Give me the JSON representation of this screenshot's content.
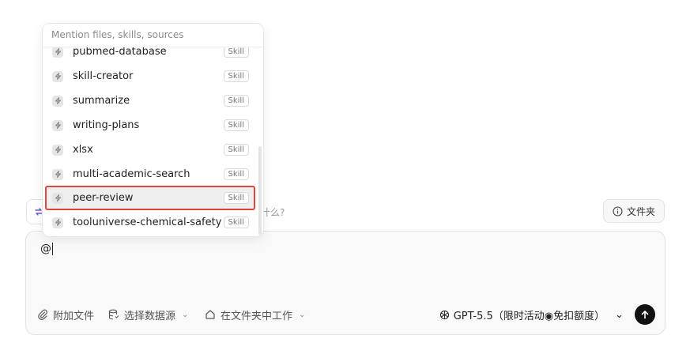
{
  "prompt_row": {
    "suggestion_text": "什么?",
    "folder_label": "文件夹"
  },
  "composer": {
    "value": "@",
    "toolbar": {
      "attach_label": "附加文件",
      "datasource_label": "选择数据源",
      "workspace_label": "在文件夹中工作",
      "model_label": "GPT-5.5（限时活动◉免扣额度）"
    }
  },
  "mention_popup": {
    "placeholder": "Mention files, skills, sources",
    "items": [
      {
        "label": "pubmed-database",
        "badge": "Skill"
      },
      {
        "label": "skill-creator",
        "badge": "Skill"
      },
      {
        "label": "summarize",
        "badge": "Skill"
      },
      {
        "label": "writing-plans",
        "badge": "Skill"
      },
      {
        "label": "xlsx",
        "badge": "Skill"
      },
      {
        "label": "multi-academic-search",
        "badge": "Skill"
      },
      {
        "label": "peer-review",
        "badge": "Skill",
        "selected": true
      },
      {
        "label": "tooluniverse-chemical-safety",
        "badge": "Skill"
      }
    ]
  },
  "colors": {
    "selection_outline": "#e0443a",
    "send_button": "#111111",
    "suggestion_icon": "#6b5bd6"
  },
  "icons": [
    "skill-bolt-icon",
    "refresh-icon",
    "info-icon",
    "paperclip-icon",
    "database-icon",
    "home-folder-icon",
    "openai-icon",
    "chevron-down-icon",
    "arrow-up-icon"
  ]
}
